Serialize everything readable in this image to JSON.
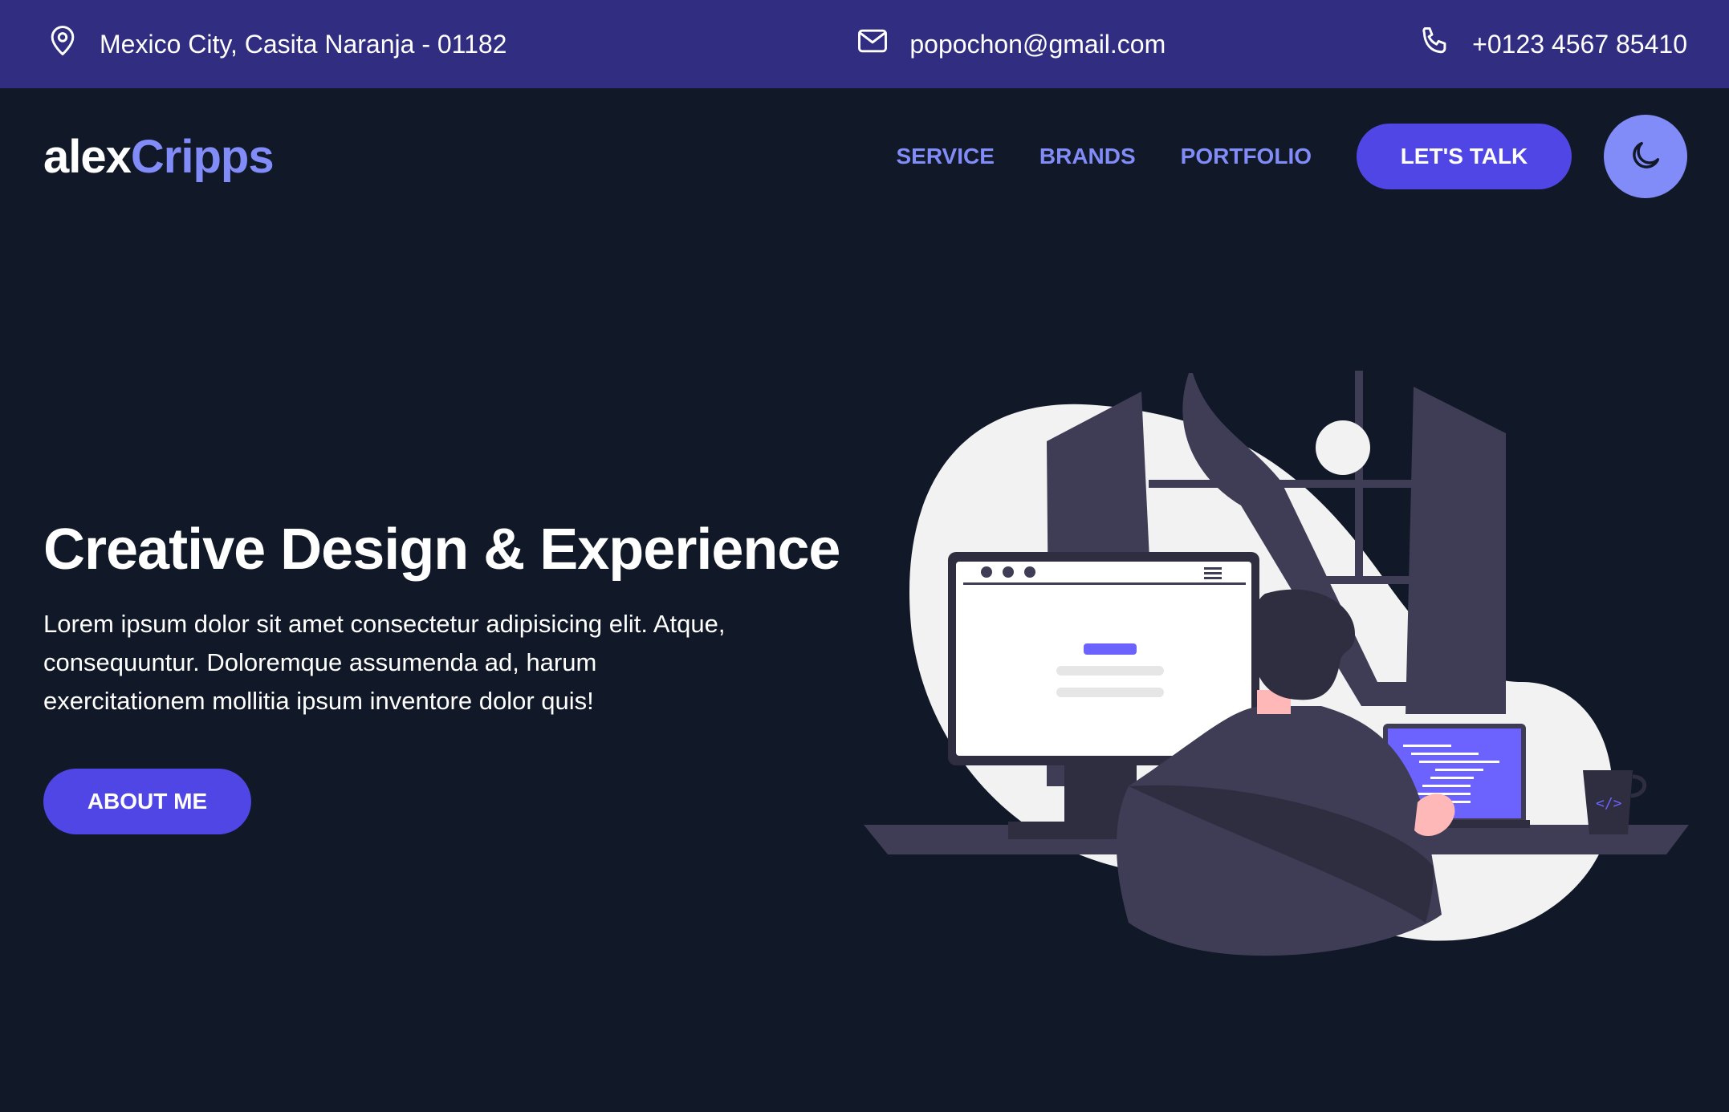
{
  "topbar": {
    "address": "Mexico City, Casita Naranja - 01182",
    "email": "popochon@gmail.com",
    "phone": "+0123 4567 85410"
  },
  "brand": {
    "first": "alex",
    "second": "Cripps"
  },
  "nav": {
    "links": [
      "SERVICE",
      "BRANDS",
      "PORTFOLIO"
    ],
    "cta": "LET'S TALK"
  },
  "hero": {
    "title": "Creative Design & Experience",
    "text": "Lorem ipsum dolor sit amet consectetur adipisicing elit. Atque, consequuntur. Doloremque assumenda ad, harum exercitationem mollitia ipsum inventore dolor quis!",
    "button": "ABOUT ME"
  },
  "icons": {
    "address": "map-pin-icon",
    "email": "envelope-icon",
    "phone": "phone-icon",
    "theme": "moon-icon"
  },
  "colors": {
    "topbar_bg": "#312e81",
    "page_bg": "#111827",
    "accent": "#4f46e5",
    "accent_light": "#818cf8"
  }
}
